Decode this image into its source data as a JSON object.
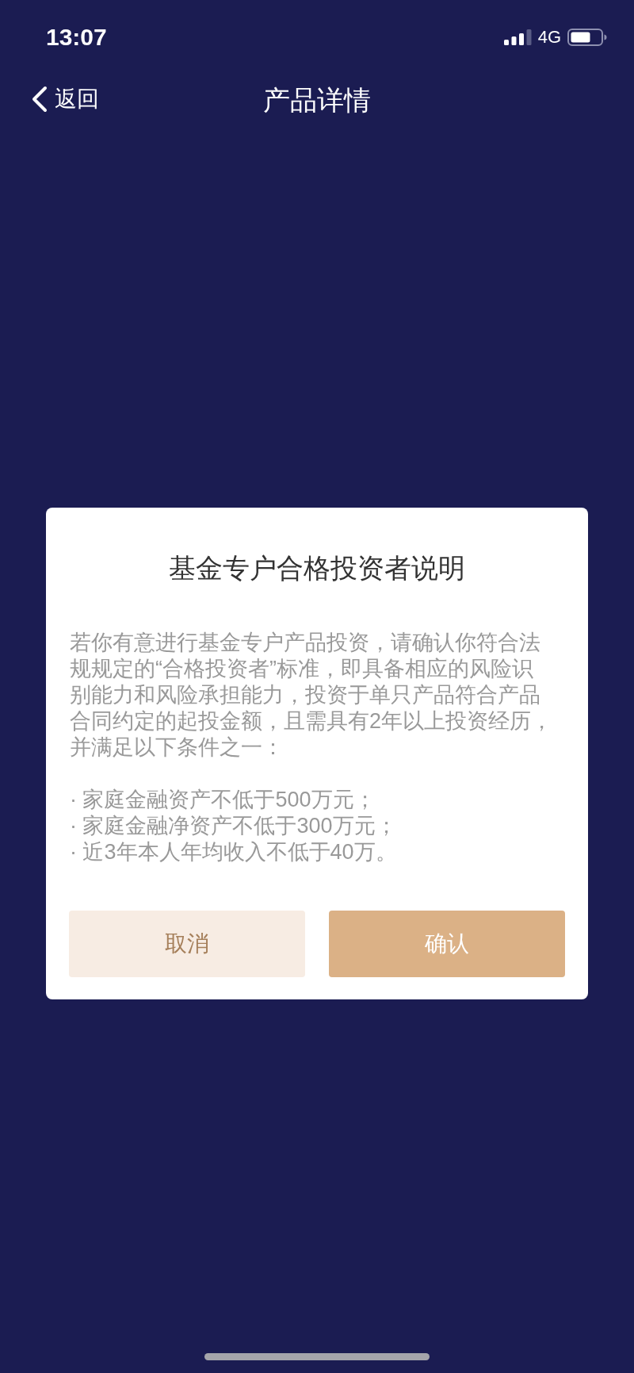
{
  "status_bar": {
    "time": "13:07",
    "network": "4G"
  },
  "nav": {
    "back_label": "返回",
    "title": "产品详情"
  },
  "dialog": {
    "title": "基金专户合格投资者说明",
    "body": "若你有意进行基金专户产品投资，请确认你符合法规规定的“合格投资者”标准，即具备相应的风险识别能力和风险承担能力，投资于单只产品符合产品合同约定的起投金额，且需具有2年以上投资经历，并满足以下条件之一：",
    "conditions": [
      "· 家庭金融资产不低于500万元；",
      "· 家庭金融净资产不低于300万元；",
      "· 近3年本人年均收入不低于40万。"
    ],
    "buttons": [
      {
        "label": "取消",
        "kind": "secondary"
      },
      {
        "label": "确认",
        "kind": "primary"
      }
    ]
  }
}
